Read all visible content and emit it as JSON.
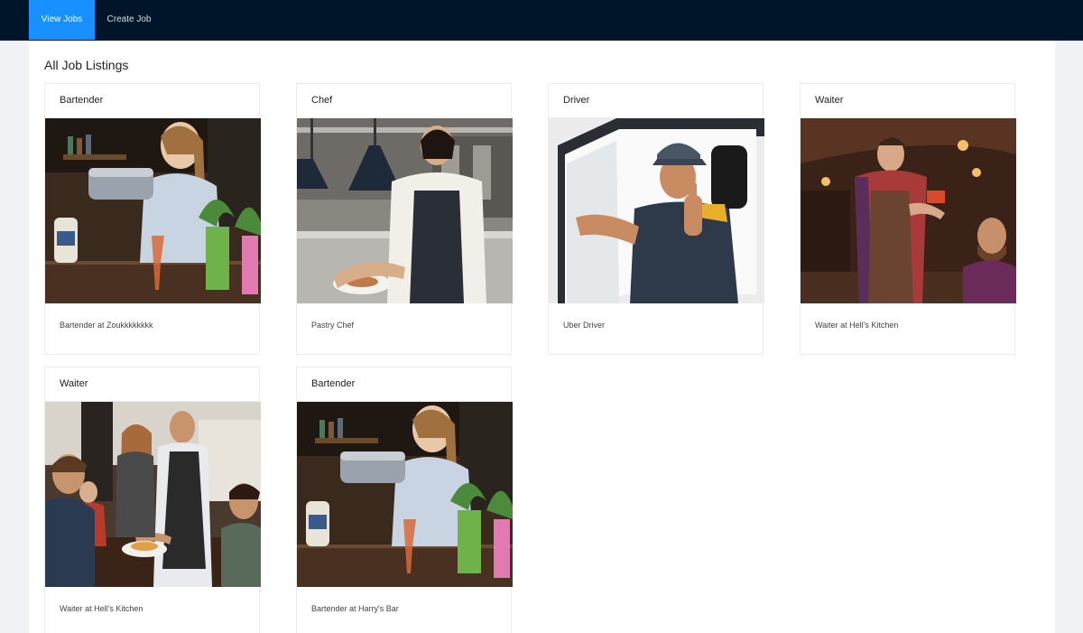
{
  "nav": {
    "items": [
      {
        "label": "View Jobs",
        "active": true
      },
      {
        "label": "Create Job",
        "active": false
      }
    ]
  },
  "page": {
    "title": "All Job Listings"
  },
  "jobs": [
    {
      "title": "Bartender",
      "description": "Bartender at Zoukkkkkkkk",
      "image": "bartender-photo"
    },
    {
      "title": "Chef",
      "description": "Pastry Chef",
      "image": "chef-photo"
    },
    {
      "title": "Driver",
      "description": "Uber Driver",
      "image": "driver-photo"
    },
    {
      "title": "Waiter",
      "description": "Waiter at Hell's Kitchen",
      "image": "waiter-photo"
    },
    {
      "title": "Waiter",
      "description": "Waiter at Hell's Kitchen",
      "image": "waiter-group-photo"
    },
    {
      "title": "Bartender",
      "description": "Bartender at Harry's Bar",
      "image": "bartender-photo"
    }
  ],
  "colors": {
    "navbar": "#001529",
    "active_tab": "#1890ff",
    "page_bg": "#f0f2f5"
  }
}
